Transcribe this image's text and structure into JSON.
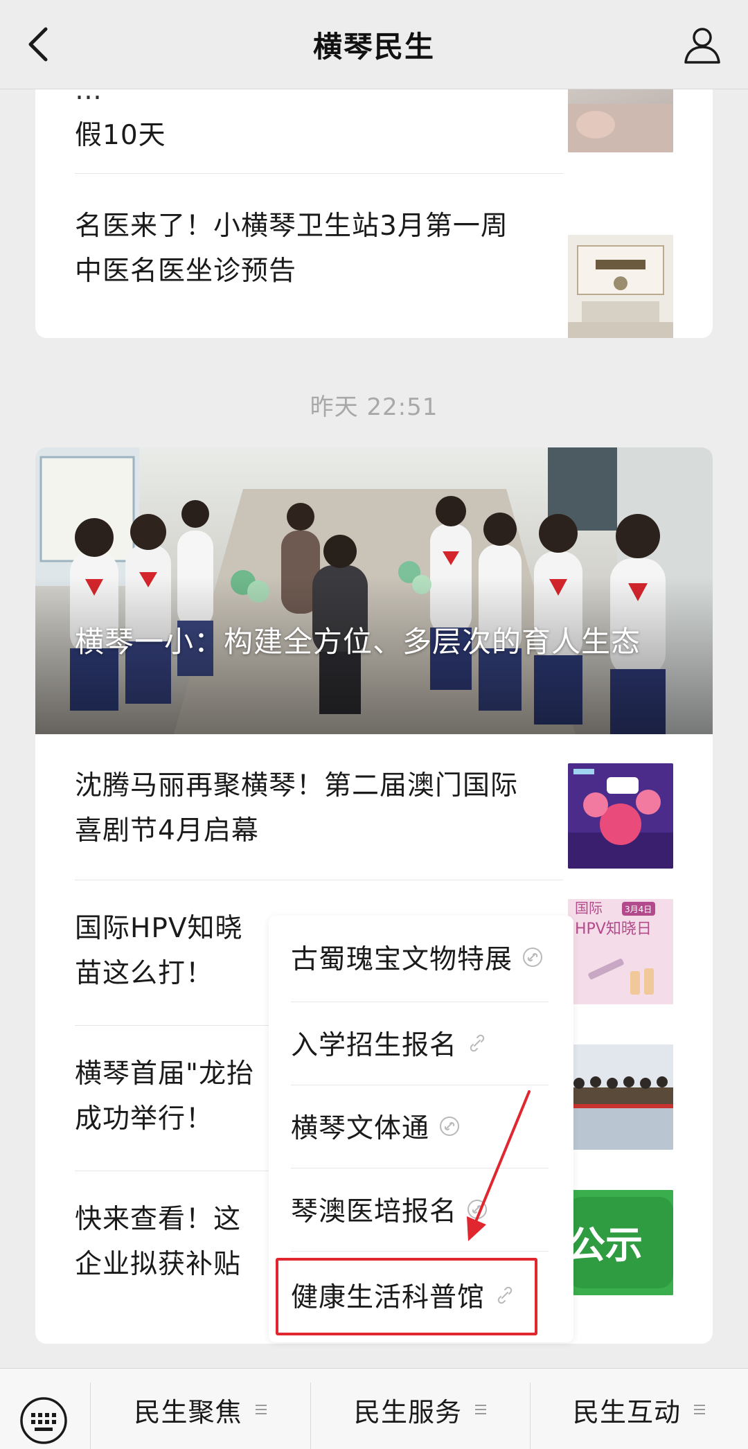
{
  "header": {
    "title": "横琴民生"
  },
  "top_card": {
    "articles": [
      {
        "title": "假10天",
        "partial_top": "…"
      },
      {
        "title": "名医来了！小横琴卫生站3月第一周中医名医坐诊预告"
      }
    ]
  },
  "timestamp": "昨天 22:51",
  "main_card": {
    "hero_title": "横琴一小：构建全方位、多层次的育人生态",
    "articles": [
      {
        "title": "沈腾马丽再聚横琴！第二届澳门国际喜剧节4月启幕"
      },
      {
        "title": "国际HPV知晓苗这么打！"
      },
      {
        "title": "横琴首届\"龙抬成功举行！"
      },
      {
        "title": "快来查看！这企业拟获补贴"
      }
    ]
  },
  "thumb_text": {
    "hpv_line1": "国际",
    "hpv_tag": "3月4日",
    "hpv_line2": "HPV知晓日",
    "notice": "公示"
  },
  "popup_menu": {
    "items": [
      {
        "label": "古蜀瑰宝文物特展"
      },
      {
        "label": "入学招生报名"
      },
      {
        "label": "横琴文体通"
      },
      {
        "label": "琴澳医培报名"
      },
      {
        "label": "健康生活科普馆"
      }
    ],
    "highlighted_index": 4
  },
  "bottom_bar": {
    "tabs": [
      {
        "label": "民生聚焦"
      },
      {
        "label": "民生服务"
      },
      {
        "label": "民生互动"
      }
    ]
  },
  "colors": {
    "background": "#ededed",
    "card": "#ffffff",
    "highlight": "#e0262f",
    "timestamp": "#a8a8a8"
  }
}
